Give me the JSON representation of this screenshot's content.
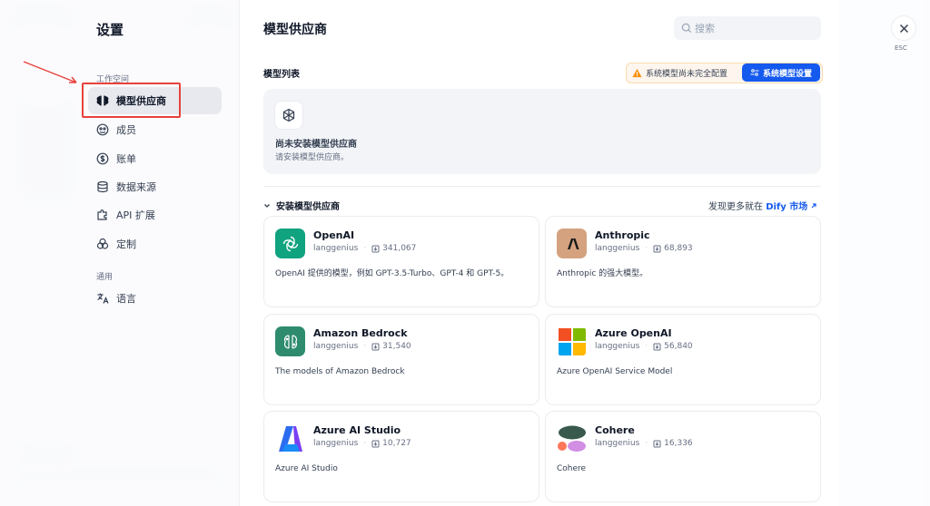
{
  "sidebar": {
    "title": "设置",
    "workspace_label": "工作空间",
    "general_label": "通用",
    "items": [
      {
        "label": "模型供应商",
        "icon": "brain-icon"
      },
      {
        "label": "成员",
        "icon": "members-icon"
      },
      {
        "label": "账单",
        "icon": "dollar-icon"
      },
      {
        "label": "数据来源",
        "icon": "database-icon"
      },
      {
        "label": "API 扩展",
        "icon": "puzzle-icon"
      },
      {
        "label": "定制",
        "icon": "customize-icon"
      }
    ],
    "general_items": [
      {
        "label": "语言",
        "icon": "translate-icon"
      }
    ]
  },
  "main": {
    "title": "模型供应商",
    "search_placeholder": "搜索",
    "model_list_label": "模型列表",
    "warning_text": "系统模型尚未完全配置",
    "system_settings_label": "系统模型设置",
    "empty_title": "尚未安装模型供应商",
    "empty_sub": "请安装模型供应商。",
    "install_label": "安装模型供应商",
    "discover_prefix": "发现更多就在",
    "marketplace_label": "Dify 市场",
    "providers": [
      {
        "name": "OpenAI",
        "author": "langgenius",
        "downloads": "341,067",
        "desc": "OpenAI 提供的模型，例如 GPT-3.5-Turbo、GPT-4 和 GPT-5。",
        "icon": "openai-logo"
      },
      {
        "name": "Anthropic",
        "author": "langgenius",
        "downloads": "68,893",
        "desc": "Anthropic 的强大模型。",
        "icon": "anthropic-logo"
      },
      {
        "name": "Amazon Bedrock",
        "author": "langgenius",
        "downloads": "31,540",
        "desc": "The models of Amazon Bedrock",
        "icon": "bedrock-logo"
      },
      {
        "name": "Azure OpenAI",
        "author": "langgenius",
        "downloads": "56,840",
        "desc": "Azure OpenAI Service Model",
        "icon": "microsoft-logo"
      },
      {
        "name": "Azure AI Studio",
        "author": "langgenius",
        "downloads": "10,727",
        "desc": "Azure AI Studio",
        "icon": "azure-ai-logo"
      },
      {
        "name": "Cohere",
        "author": "langgenius",
        "downloads": "16,336",
        "desc": "Cohere",
        "icon": "cohere-logo"
      }
    ]
  },
  "close": {
    "esc_label": "ESC"
  },
  "colors": {
    "accent": "#155aef",
    "highlight": "#e8413b",
    "warning": "#f79009"
  }
}
